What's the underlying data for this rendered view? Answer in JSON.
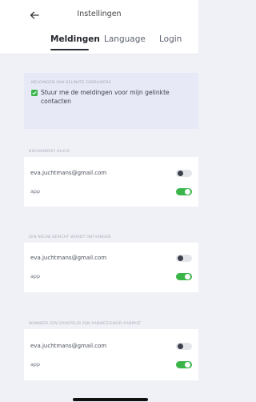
{
  "header": {
    "title": "Instellingen",
    "back_icon": "arrow-left-icon"
  },
  "tabs": [
    {
      "label": "Meldingen",
      "active": true
    },
    {
      "label": "Language",
      "active": false
    },
    {
      "label": "Login",
      "active": false
    }
  ],
  "linked_users": {
    "heading": "MELDINGEN VAN GELINKTE GEBRUIKERS",
    "checkbox_label": "Stuur me de meldingen voor mijn gelinkte contacten",
    "checked": true
  },
  "sections": [
    {
      "heading": "NIEUWSBRIEF OLICIA",
      "rows": [
        {
          "label": "eva.juchtmans@gmail.com",
          "enabled": false
        },
        {
          "label": "app",
          "enabled": true
        }
      ]
    },
    {
      "heading": "EEN NIEUW BERICHT WORDT ONTVANGEN",
      "rows": [
        {
          "label": "eva.juchtmans@gmail.com",
          "enabled": false
        },
        {
          "label": "app",
          "enabled": true
        }
      ]
    },
    {
      "heading": "WANNEER EEN GROEPSLID ZIJN AANWEZIGHEID AANPAST",
      "rows": [
        {
          "label": "eva.juchtmans@gmail.com",
          "enabled": false
        },
        {
          "label": "app",
          "enabled": true
        }
      ]
    }
  ],
  "colors": {
    "accent_green": "#3bb54a",
    "background": "#eff1f6",
    "linked_panel": "#e8e9f6"
  }
}
